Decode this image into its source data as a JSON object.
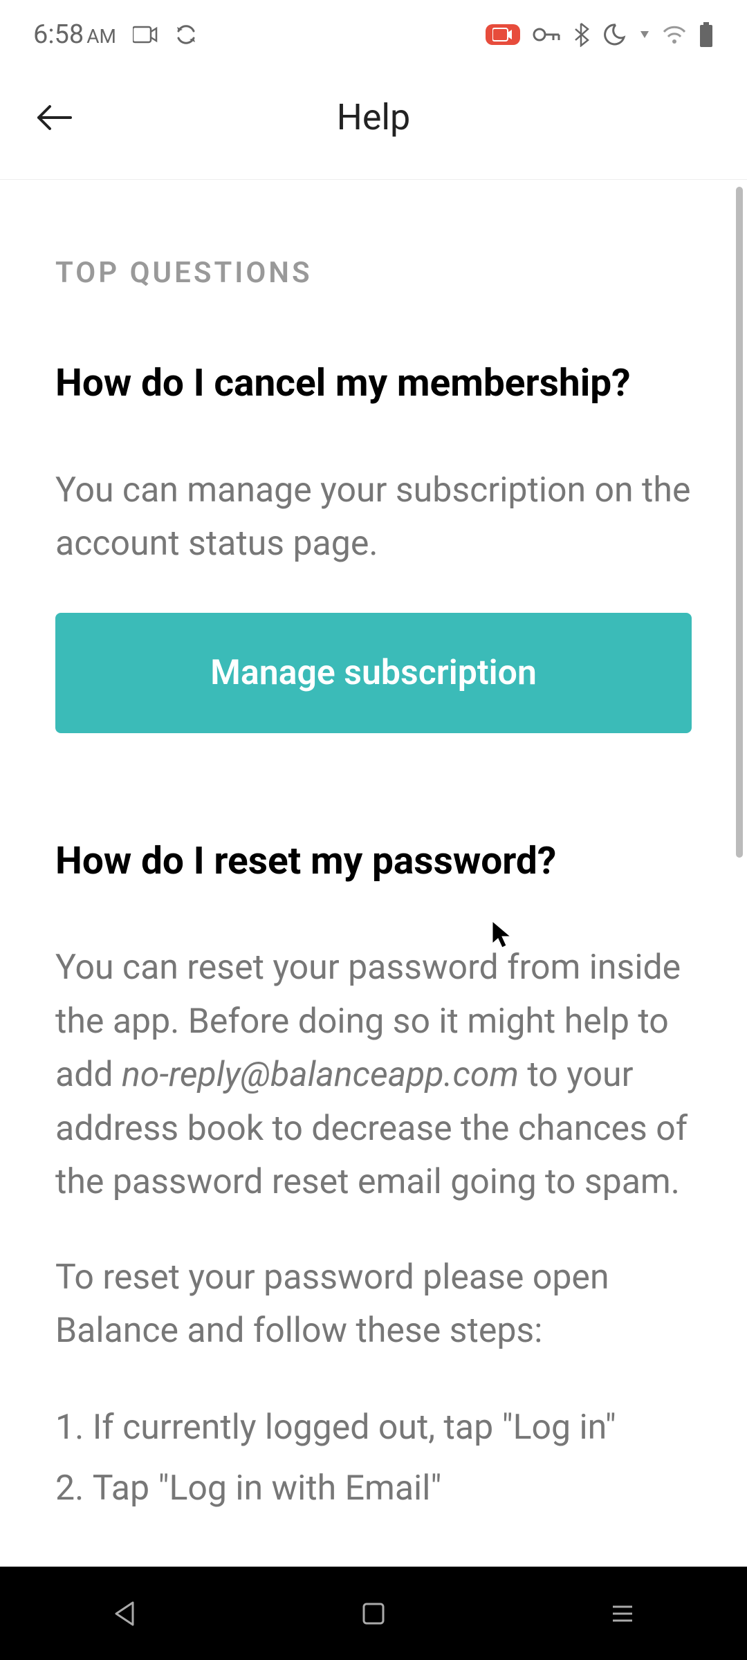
{
  "status_bar": {
    "time": "6:58",
    "am_pm": "AM"
  },
  "header": {
    "title": "Help"
  },
  "content": {
    "section_label": "TOP QUESTIONS",
    "q1": {
      "title": "How do I cancel my membership?",
      "body": "You can manage your subscription on the account status page.",
      "cta_label": "Manage subscription"
    },
    "q2": {
      "title": "How do I reset my password?",
      "body_part1": "You can reset your password from inside the app. Before doing so it might help to add ",
      "email": "no-reply@balanceapp.com",
      "body_part2": " to your address book to decrease the chances of the password reset email going to spam.",
      "body2": "To reset your password please open Balance and follow these steps:",
      "steps": [
        "If currently logged out, tap \"Log in\"",
        "Tap \"Log in with Email\""
      ]
    }
  },
  "colors": {
    "cta_bg": "#3bbbb8",
    "record_badge": "#e74c3c"
  }
}
